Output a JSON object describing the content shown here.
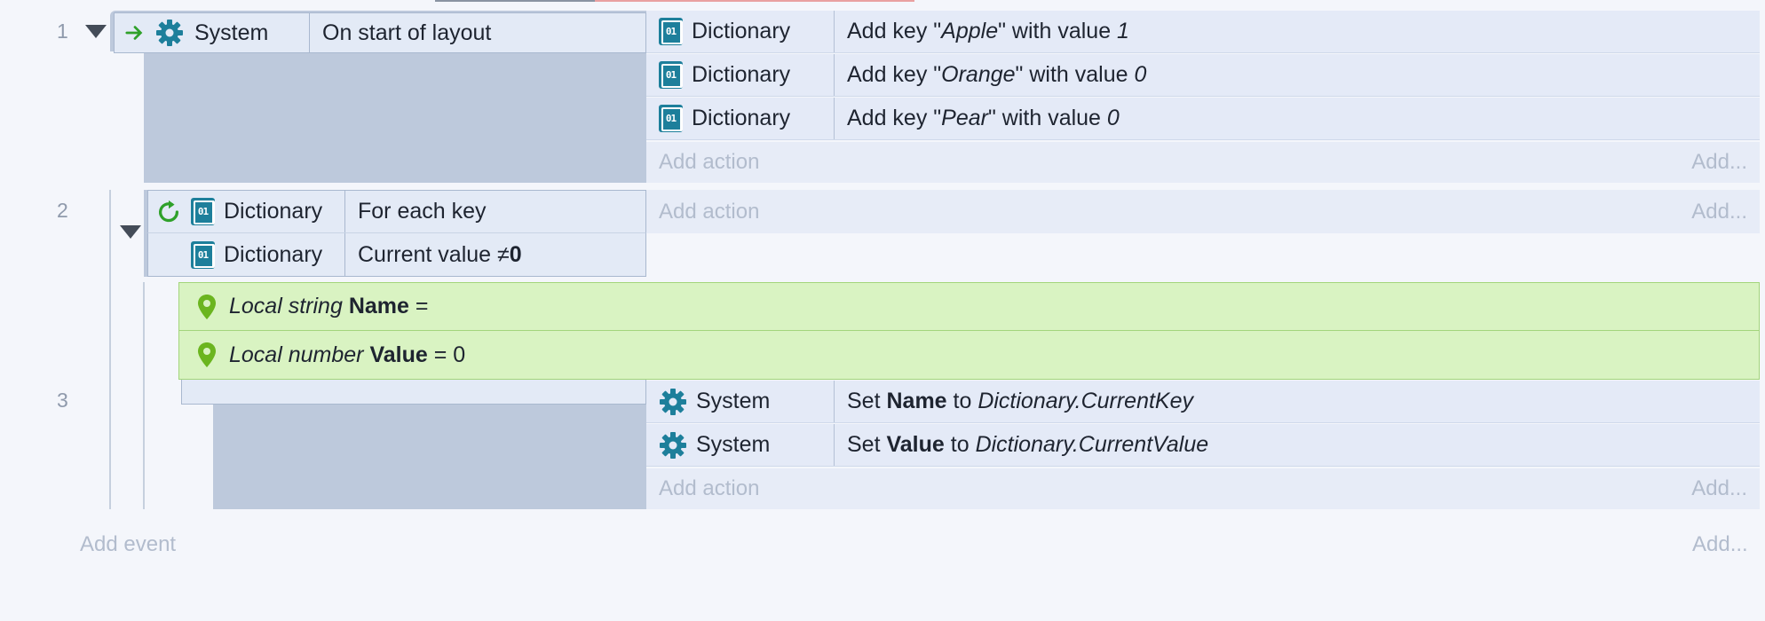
{
  "rows": [
    "1",
    "2",
    "3"
  ],
  "event1": {
    "trigger_object": "System",
    "trigger_text": "On start of layout",
    "actions": [
      {
        "object": "Dictionary",
        "pre": "Add key \"",
        "key": "Apple",
        "mid": "\" with value ",
        "value": "1"
      },
      {
        "object": "Dictionary",
        "pre": "Add key \"",
        "key": "Orange",
        "mid": "\" with value ",
        "value": "0"
      },
      {
        "object": "Dictionary",
        "pre": "Add key \"",
        "key": "Pear",
        "mid": "\" with value ",
        "value": "0"
      }
    ]
  },
  "event2": {
    "conditions": [
      {
        "object": "Dictionary",
        "text": "For each key"
      },
      {
        "object": "Dictionary",
        "text_pre": "Current value ≠ ",
        "text_bold": "0"
      }
    ]
  },
  "locals": [
    {
      "type": "Local string",
      "name": "Name",
      "rest": " ="
    },
    {
      "type": "Local number",
      "name": "Value",
      "rest": " = 0"
    }
  ],
  "event3": {
    "actions": [
      {
        "object": "System",
        "pre": "Set ",
        "bold": "Name",
        "mid": " to ",
        "expr": "Dictionary.CurrentKey"
      },
      {
        "object": "System",
        "pre": "Set ",
        "bold": "Value",
        "mid": " to ",
        "expr": "Dictionary.CurrentValue"
      }
    ]
  },
  "labels": {
    "add_action": "Add action",
    "add_short": "Add...",
    "add_event": "Add event"
  },
  "icons": {
    "system": "gear-icon",
    "dictionary": "dictionary-icon",
    "trigger": "arrow-right-icon",
    "loop": "loop-icon",
    "local": "pin-icon"
  },
  "colors": {
    "background": "#f4f6fb",
    "event_block": "#bdc9dc",
    "action_row": "#e4eaf7",
    "local_bg": "#d9f3c2",
    "icon_teal": "#1d7f9b",
    "trigger_green": "#2fa12a"
  }
}
